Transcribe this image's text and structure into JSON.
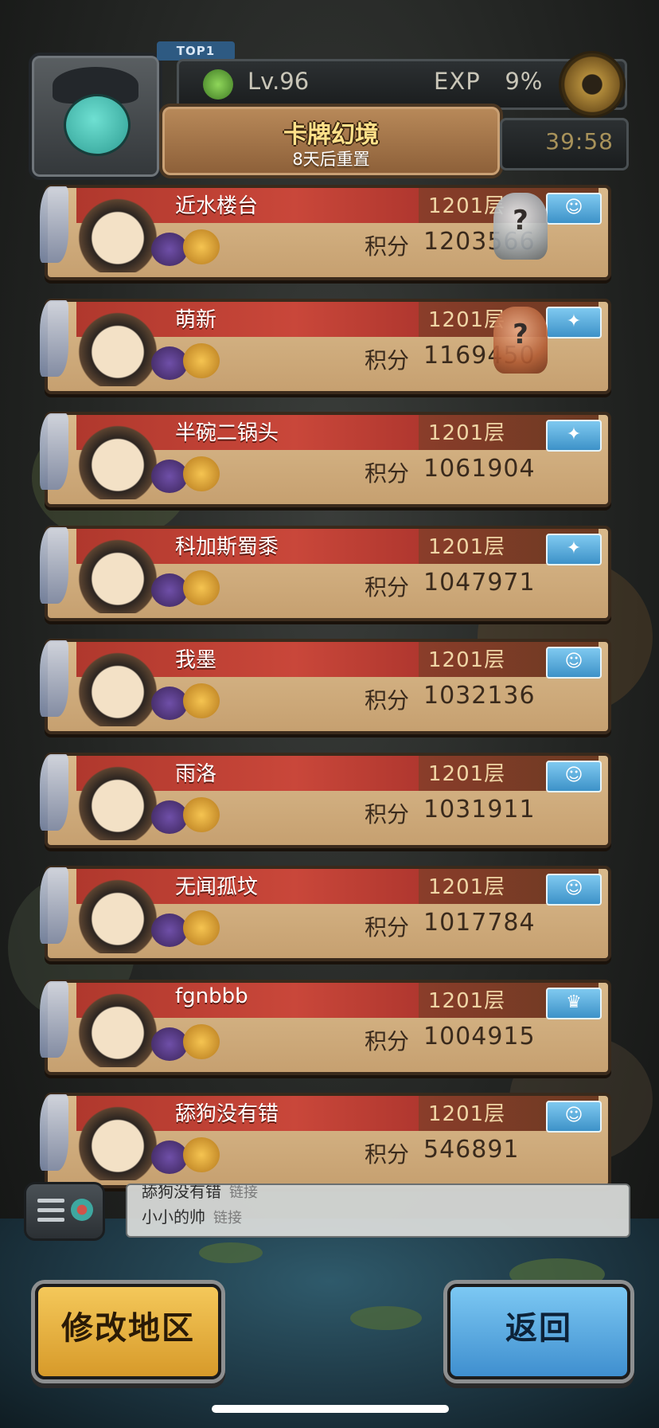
{
  "header": {
    "top_badge": "TOP1",
    "level": "Lv.96",
    "exp": "EXP   9%",
    "title": "卡牌幻境",
    "subtitle": "8天后重置",
    "timer": "39:58"
  },
  "ranks": [
    {
      "name": "近水楼台",
      "floor": "1201层",
      "score_label": "积分",
      "score": "1203566",
      "trophy": "silver",
      "icon": "pumpkin-icon"
    },
    {
      "name": "萌新",
      "floor": "1201层",
      "score_label": "积分",
      "score": "1169450",
      "trophy": "bronze",
      "icon": "wings-icon"
    },
    {
      "name": "半碗二锅头",
      "floor": "1201层",
      "score_label": "积分",
      "score": "1061904",
      "trophy": "",
      "icon": "wings-icon"
    },
    {
      "name": "科加斯蜀黍",
      "floor": "1201层",
      "score_label": "积分",
      "score": "1047971",
      "trophy": "",
      "icon": "wings-icon"
    },
    {
      "name": "我墨",
      "floor": "1201层",
      "score_label": "积分",
      "score": "1032136",
      "trophy": "",
      "icon": "pumpkin-icon"
    },
    {
      "name": "雨洛",
      "floor": "1201层",
      "score_label": "积分",
      "score": "1031911",
      "trophy": "",
      "icon": "pumpkin-icon"
    },
    {
      "name": "无闻孤坟",
      "floor": "1201层",
      "score_label": "积分",
      "score": "1017784",
      "trophy": "",
      "icon": "pumpkin-icon"
    },
    {
      "name": "fgnbbb",
      "floor": "1201层",
      "score_label": "积分",
      "score": "1004915",
      "trophy": "",
      "icon": "crown-icon"
    },
    {
      "name": "舔狗没有错",
      "floor": "1201层",
      "score_label": "积分",
      "score": "546891",
      "trophy": "",
      "icon": "pumpkin-icon"
    }
  ],
  "chat": {
    "lines": [
      {
        "user": "舔狗没有错",
        "link": "链接"
      },
      {
        "user": "小小的帅",
        "link": "链接"
      }
    ]
  },
  "buttons": {
    "region": "修改地区",
    "back": "返回"
  },
  "colors": {
    "banner_red": "#c9473a",
    "card_tan": "#d9b98b",
    "region_button": "#f4c85a",
    "back_button": "#7cc8f3"
  }
}
